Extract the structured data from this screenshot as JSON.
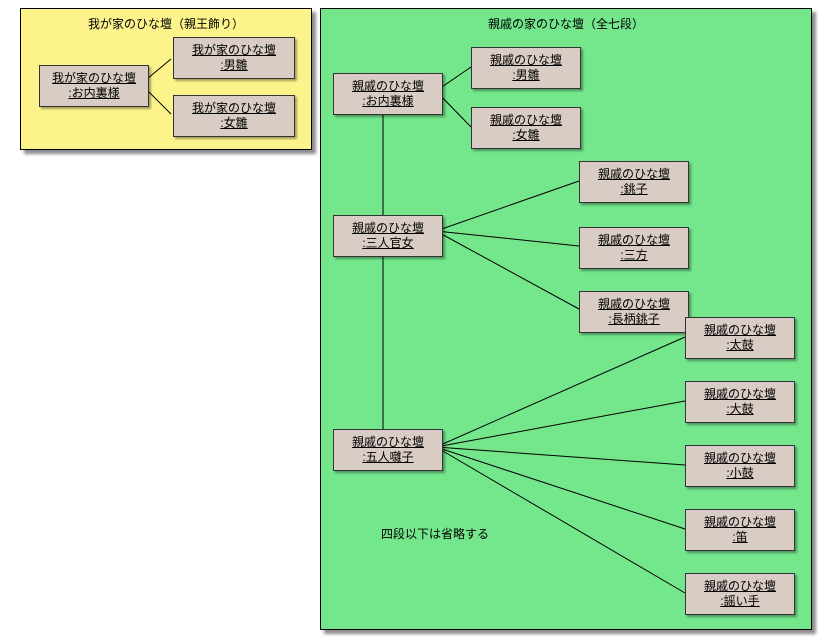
{
  "left": {
    "title": "我が家のひな壇（親王飾り）",
    "nodes": {
      "root": {
        "l1": "我が家のひな壇",
        "l2": ":お内裏様"
      },
      "male": {
        "l1": "我が家のひな壇",
        "l2": ":男雛"
      },
      "female": {
        "l1": "我が家のひな壇",
        "l2": ":女雛"
      }
    }
  },
  "right": {
    "title": "親戚の家のひな壇（全七段）",
    "note": "四段以下は省略する",
    "nodes": {
      "odairi": {
        "l1": "親戚のひな壇",
        "l2": ":お内裏様"
      },
      "male": {
        "l1": "親戚のひな壇",
        "l2": ":男雛"
      },
      "female": {
        "l1": "親戚のひな壇",
        "l2": ":女雛"
      },
      "sannin": {
        "l1": "親戚のひな壇",
        "l2": ":三人官女"
      },
      "choshi": {
        "l1": "親戚のひな壇",
        "l2": ":銚子"
      },
      "sanpo": {
        "l1": "親戚のひな壇",
        "l2": ":三方"
      },
      "nagae": {
        "l1": "親戚のひな壇",
        "l2": ":長柄銚子"
      },
      "gonin": {
        "l1": "親戚のひな壇",
        "l2": ":五人囃子"
      },
      "taiko": {
        "l1": "親戚のひな壇",
        "l2": ":太鼓"
      },
      "odaiko": {
        "l1": "親戚のひな壇",
        "l2": ":大鼓"
      },
      "kotsu": {
        "l1": "親戚のひな壇",
        "l2": ":小鼓"
      },
      "fue": {
        "l1": "親戚のひな壇",
        "l2": ":笛"
      },
      "utaite": {
        "l1": "親戚のひな壇",
        "l2": ":謡い手"
      }
    }
  }
}
